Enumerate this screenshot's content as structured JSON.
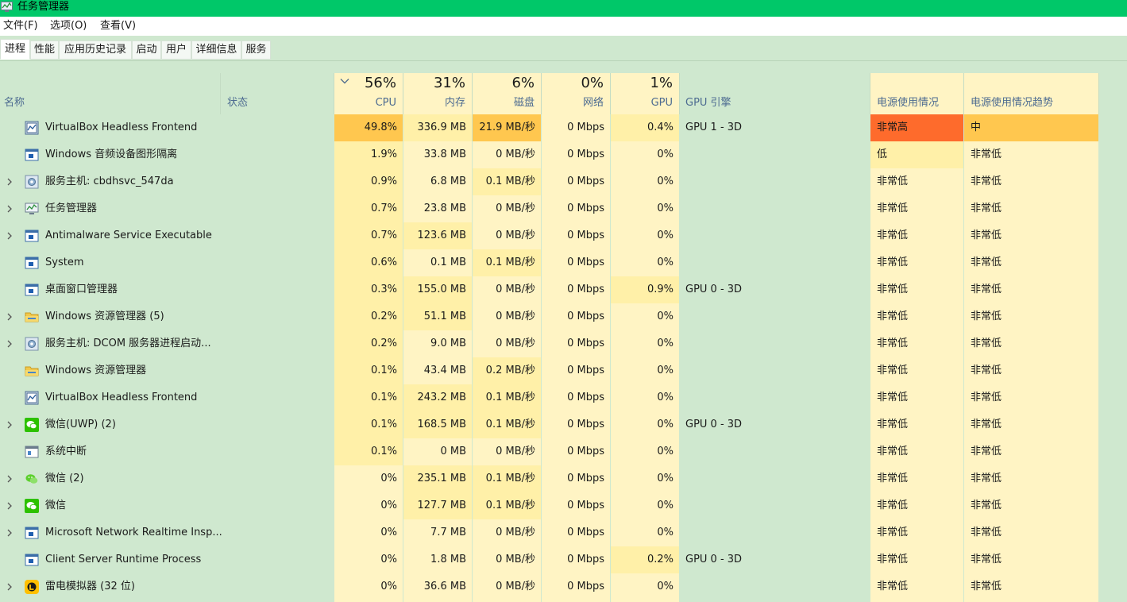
{
  "window": {
    "title": "任务管理器",
    "app_icon": "task-manager-icon",
    "titlebar_color": "#00c869"
  },
  "menu": [
    "文件(F)",
    "选项(O)",
    "查看(V)"
  ],
  "tabs": [
    {
      "label": "进程",
      "active": true
    },
    {
      "label": "性能"
    },
    {
      "label": "应用历史记录"
    },
    {
      "label": "启动"
    },
    {
      "label": "用户"
    },
    {
      "label": "详细信息"
    },
    {
      "label": "服务"
    }
  ],
  "header": {
    "name": "名称",
    "status": "状态",
    "cpu": {
      "pct": "56%",
      "label": "CPU",
      "sorted": true
    },
    "memory": {
      "pct": "31%",
      "label": "内存"
    },
    "disk": {
      "pct": "6%",
      "label": "磁盘"
    },
    "network": {
      "pct": "0%",
      "label": "网络"
    },
    "gpu": {
      "pct": "1%",
      "label": "GPU"
    },
    "gpu_engine": "GPU 引擎",
    "power": "电源使用情况",
    "power_trend": "电源使用情况趋势"
  },
  "colors": {
    "heat_very_high": "#fe6b2c",
    "heat_high": "#ffc74f",
    "heat_mid": "#fff0a8",
    "heat_light": "#fff4c4",
    "row_bg": "#cfe8cf"
  },
  "processes": [
    {
      "name": "VirtualBox Headless Frontend",
      "icon": "virtualbox-icon",
      "expand": false,
      "cpu": "49.8%",
      "mem": "336.9 MB",
      "disk": "21.9 MB/秒",
      "net": "0 Mbps",
      "gpu": "0.4%",
      "engine": "GPU 1 - 3D",
      "power": "非常高",
      "trend": "中"
    },
    {
      "name": "Windows 音频设备图形隔离",
      "icon": "app-window-icon",
      "expand": false,
      "cpu": "1.9%",
      "mem": "33.8 MB",
      "disk": "0 MB/秒",
      "net": "0 Mbps",
      "gpu": "0%",
      "engine": "",
      "power": "低",
      "trend": "非常低"
    },
    {
      "name": "服务主机: cbdhsvc_547da",
      "icon": "service-gear-icon",
      "expand": true,
      "cpu": "0.9%",
      "mem": "6.8 MB",
      "disk": "0.1 MB/秒",
      "net": "0 Mbps",
      "gpu": "0%",
      "engine": "",
      "power": "非常低",
      "trend": "非常低"
    },
    {
      "name": "任务管理器",
      "icon": "task-manager-icon",
      "expand": true,
      "cpu": "0.7%",
      "mem": "23.8 MB",
      "disk": "0 MB/秒",
      "net": "0 Mbps",
      "gpu": "0%",
      "engine": "",
      "power": "非常低",
      "trend": "非常低"
    },
    {
      "name": "Antimalware Service Executable",
      "icon": "app-window-icon",
      "expand": true,
      "cpu": "0.7%",
      "mem": "123.6 MB",
      "disk": "0 MB/秒",
      "net": "0 Mbps",
      "gpu": "0%",
      "engine": "",
      "power": "非常低",
      "trend": "非常低"
    },
    {
      "name": "System",
      "icon": "app-window-icon",
      "expand": false,
      "cpu": "0.6%",
      "mem": "0.1 MB",
      "disk": "0.1 MB/秒",
      "net": "0 Mbps",
      "gpu": "0%",
      "engine": "",
      "power": "非常低",
      "trend": "非常低"
    },
    {
      "name": "桌面窗口管理器",
      "icon": "app-window-icon",
      "expand": false,
      "cpu": "0.3%",
      "mem": "155.0 MB",
      "disk": "0 MB/秒",
      "net": "0 Mbps",
      "gpu": "0.9%",
      "engine": "GPU 0 - 3D",
      "power": "非常低",
      "trend": "非常低"
    },
    {
      "name": "Windows 资源管理器 (5)",
      "icon": "folder-icon",
      "expand": true,
      "cpu": "0.2%",
      "mem": "51.1 MB",
      "disk": "0 MB/秒",
      "net": "0 Mbps",
      "gpu": "0%",
      "engine": "",
      "power": "非常低",
      "trend": "非常低"
    },
    {
      "name": "服务主机: DCOM 服务器进程启动...",
      "icon": "service-gear-icon",
      "expand": true,
      "cpu": "0.2%",
      "mem": "9.0 MB",
      "disk": "0 MB/秒",
      "net": "0 Mbps",
      "gpu": "0%",
      "engine": "",
      "power": "非常低",
      "trend": "非常低"
    },
    {
      "name": "Windows 资源管理器",
      "icon": "folder-icon",
      "expand": false,
      "cpu": "0.1%",
      "mem": "43.4 MB",
      "disk": "0.2 MB/秒",
      "net": "0 Mbps",
      "gpu": "0%",
      "engine": "",
      "power": "非常低",
      "trend": "非常低"
    },
    {
      "name": "VirtualBox Headless Frontend",
      "icon": "virtualbox-icon",
      "expand": false,
      "cpu": "0.1%",
      "mem": "243.2 MB",
      "disk": "0.1 MB/秒",
      "net": "0 Mbps",
      "gpu": "0%",
      "engine": "",
      "power": "非常低",
      "trend": "非常低"
    },
    {
      "name": "微信(UWP) (2)",
      "icon": "wechat-icon",
      "expand": true,
      "cpu": "0.1%",
      "mem": "168.5 MB",
      "disk": "0.1 MB/秒",
      "net": "0 Mbps",
      "gpu": "0%",
      "engine": "GPU 0 - 3D",
      "power": "非常低",
      "trend": "非常低"
    },
    {
      "name": "系统中断",
      "icon": "system-interrupt-icon",
      "expand": false,
      "cpu": "0.1%",
      "mem": "0 MB",
      "disk": "0 MB/秒",
      "net": "0 Mbps",
      "gpu": "0%",
      "engine": "",
      "power": "非常低",
      "trend": "非常低"
    },
    {
      "name": "微信 (2)",
      "icon": "wechat-light-icon",
      "expand": true,
      "cpu": "0%",
      "mem": "235.1 MB",
      "disk": "0.1 MB/秒",
      "net": "0 Mbps",
      "gpu": "0%",
      "engine": "",
      "power": "非常低",
      "trend": "非常低"
    },
    {
      "name": "微信",
      "icon": "wechat-icon",
      "expand": true,
      "cpu": "0%",
      "mem": "127.7 MB",
      "disk": "0.1 MB/秒",
      "net": "0 Mbps",
      "gpu": "0%",
      "engine": "",
      "power": "非常低",
      "trend": "非常低"
    },
    {
      "name": "Microsoft Network Realtime Insp...",
      "icon": "app-window-icon",
      "expand": true,
      "cpu": "0%",
      "mem": "7.7 MB",
      "disk": "0 MB/秒",
      "net": "0 Mbps",
      "gpu": "0%",
      "engine": "",
      "power": "非常低",
      "trend": "非常低"
    },
    {
      "name": "Client Server Runtime Process",
      "icon": "app-window-icon",
      "expand": false,
      "cpu": "0%",
      "mem": "1.8 MB",
      "disk": "0 MB/秒",
      "net": "0 Mbps",
      "gpu": "0.2%",
      "engine": "GPU 0 - 3D",
      "power": "非常低",
      "trend": "非常低"
    },
    {
      "name": "雷电模拟器 (32 位)",
      "icon": "ldplayer-icon",
      "expand": true,
      "cpu": "0%",
      "mem": "36.6 MB",
      "disk": "0 MB/秒",
      "net": "0 Mbps",
      "gpu": "0%",
      "engine": "",
      "power": "非常低",
      "trend": "非常低"
    }
  ]
}
